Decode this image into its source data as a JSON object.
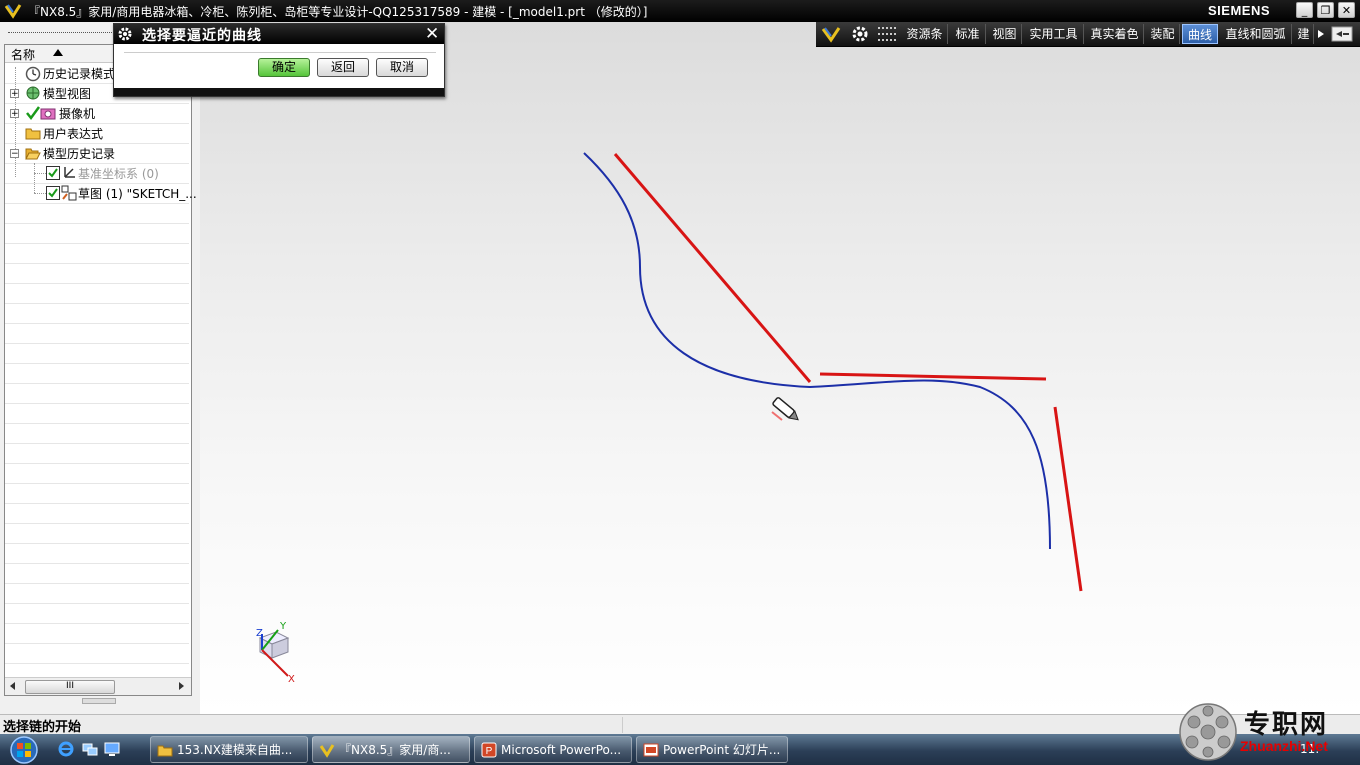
{
  "window": {
    "title": "『NX8.5』家用/商用电器冰箱、冷柜、陈列柜、岛柜等专业设计-QQ125317589 - 建模 - [_model1.prt （修改的）]",
    "brand": "SIEMENS",
    "controls": [
      "_",
      "❐",
      "✕"
    ]
  },
  "toolbar": {
    "tabs": [
      "资源条",
      "标准",
      "视图",
      "实用工具",
      "真实着色",
      "装配",
      "曲线",
      "直线和圆弧",
      "建"
    ],
    "active_tab": "曲线"
  },
  "dialog": {
    "title": "选择要逼近的曲线",
    "buttons": {
      "ok": "确定",
      "back": "返回",
      "cancel": "取消"
    },
    "close": "✕"
  },
  "navigator": {
    "header": "名称",
    "items": [
      {
        "label": "历史记录模式",
        "icon": "clock-icon"
      },
      {
        "label": "模型视图",
        "icon": "model-views-icon"
      },
      {
        "label": "摄像机",
        "icon": "camera-icon"
      },
      {
        "label": "用户表达式",
        "icon": "folder-icon"
      },
      {
        "label": "模型历史记录",
        "icon": "folder-open-icon"
      },
      {
        "label": "基准坐标系 (0)",
        "icon": "datum-csys-icon"
      },
      {
        "label": "草图 (1) \"SKETCH_...",
        "icon": "sketch-icon"
      }
    ],
    "scroll_thumb": "III"
  },
  "graphics": {
    "triad_labels": {
      "x": "X",
      "y": "Y",
      "z": "Z"
    }
  },
  "statusbar": {
    "prompt": "选择链的开始"
  },
  "taskbar": {
    "tasks": [
      "153.NX建模来自曲...",
      "『NX8.5』家用/商...",
      "Microsoft PowerPo...",
      "PowerPoint 幻灯片..."
    ],
    "clock": "11:"
  },
  "watermark": {
    "logo_text": "专职网",
    "url_text": "Zhuanzhi.Net"
  },
  "colors": {
    "curve_blue": "#1c2fa8",
    "line_red": "#d81414",
    "active_tab": "#3a6fc0"
  }
}
